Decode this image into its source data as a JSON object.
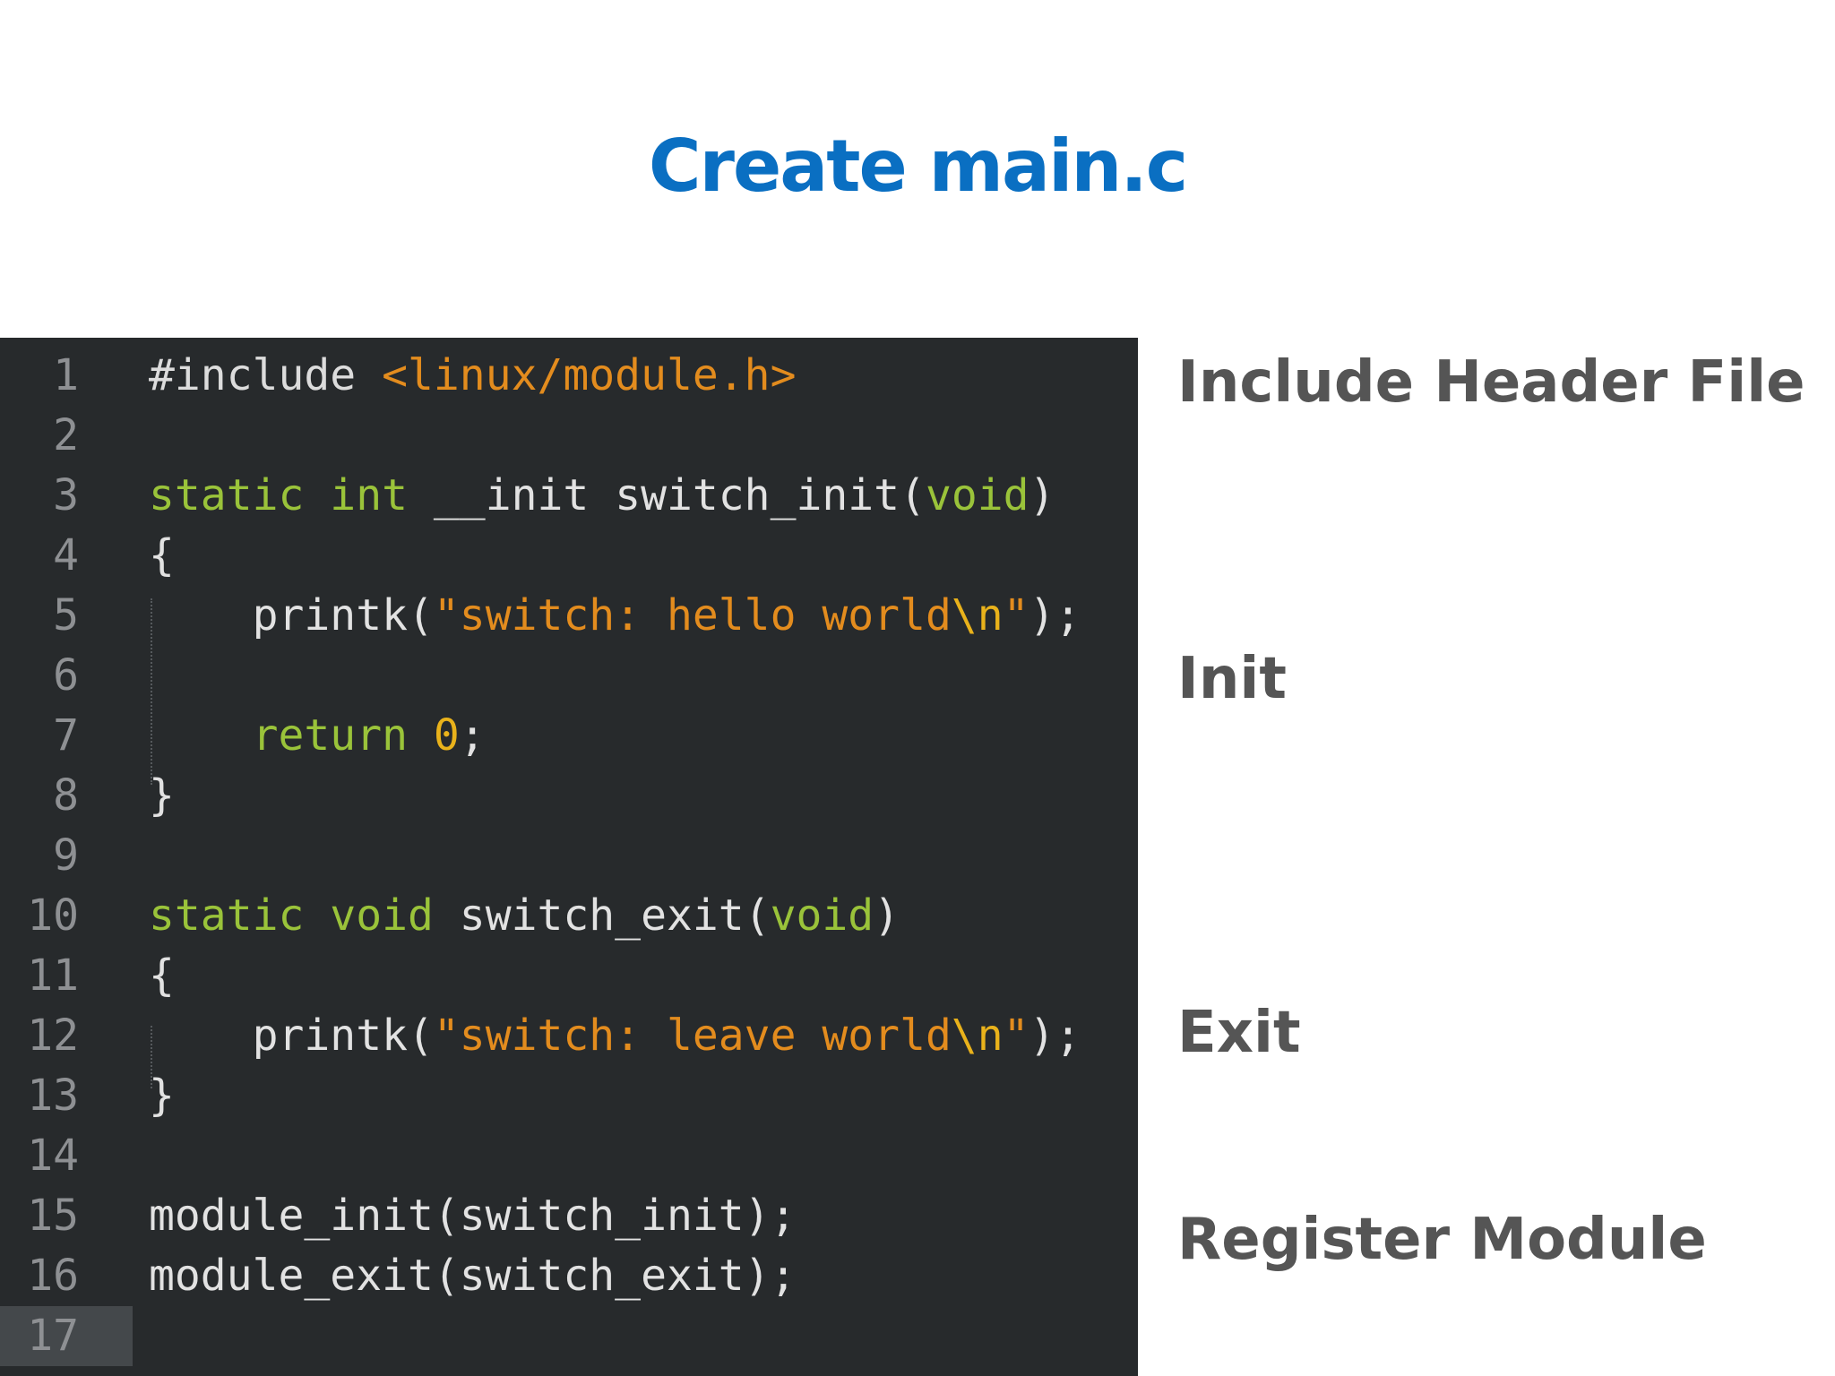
{
  "slide": {
    "title": "Create main.c"
  },
  "editor": {
    "current_line": 17,
    "lines": [
      {
        "number": "1",
        "tokens": [
          {
            "type": "pre",
            "text": "#include "
          },
          {
            "type": "inc",
            "text": "<linux/module.h>"
          }
        ]
      },
      {
        "number": "2",
        "tokens": []
      },
      {
        "number": "3",
        "tokens": [
          {
            "type": "kw",
            "text": "static"
          },
          {
            "type": "id",
            "text": " "
          },
          {
            "type": "kw",
            "text": "int"
          },
          {
            "type": "id",
            "text": " __init switch_init("
          },
          {
            "type": "kw",
            "text": "void"
          },
          {
            "type": "id",
            "text": ")"
          }
        ]
      },
      {
        "number": "4",
        "tokens": [
          {
            "type": "punct",
            "text": "{"
          }
        ]
      },
      {
        "number": "5",
        "tokens": [
          {
            "type": "id",
            "text": "    printk("
          },
          {
            "type": "str",
            "text": "\"switch: hello world"
          },
          {
            "type": "esc",
            "text": "\\n"
          },
          {
            "type": "str",
            "text": "\""
          },
          {
            "type": "id",
            "text": ");"
          }
        ]
      },
      {
        "number": "6",
        "tokens": []
      },
      {
        "number": "7",
        "tokens": [
          {
            "type": "id",
            "text": "    "
          },
          {
            "type": "kw",
            "text": "return"
          },
          {
            "type": "id",
            "text": " "
          },
          {
            "type": "num",
            "text": "0"
          },
          {
            "type": "id",
            "text": ";"
          }
        ]
      },
      {
        "number": "8",
        "tokens": [
          {
            "type": "punct",
            "text": "}"
          }
        ]
      },
      {
        "number": "9",
        "tokens": []
      },
      {
        "number": "10",
        "tokens": [
          {
            "type": "kw",
            "text": "static"
          },
          {
            "type": "id",
            "text": " "
          },
          {
            "type": "kw",
            "text": "void"
          },
          {
            "type": "id",
            "text": " switch_exit("
          },
          {
            "type": "kw",
            "text": "void"
          },
          {
            "type": "id",
            "text": ")"
          }
        ]
      },
      {
        "number": "11",
        "tokens": [
          {
            "type": "punct",
            "text": "{"
          }
        ]
      },
      {
        "number": "12",
        "tokens": [
          {
            "type": "id",
            "text": "    printk("
          },
          {
            "type": "str",
            "text": "\"switch: leave world"
          },
          {
            "type": "esc",
            "text": "\\n"
          },
          {
            "type": "str",
            "text": "\""
          },
          {
            "type": "id",
            "text": ");"
          }
        ]
      },
      {
        "number": "13",
        "tokens": [
          {
            "type": "punct",
            "text": "}"
          }
        ]
      },
      {
        "number": "14",
        "tokens": []
      },
      {
        "number": "15",
        "tokens": [
          {
            "type": "id",
            "text": "module_init(switch_init);"
          }
        ]
      },
      {
        "number": "16",
        "tokens": [
          {
            "type": "id",
            "text": "module_exit(switch_exit);"
          }
        ]
      },
      {
        "number": "17",
        "tokens": []
      }
    ]
  },
  "annotations": {
    "include": "Include Header File",
    "init": "Init",
    "exit": "Exit",
    "register": "Register Module"
  },
  "colors": {
    "title": "#0a6fc2",
    "editor_background": "#272a2c",
    "keyword": "#9ac33a",
    "string": "#e38c1e",
    "number": "#e9b21b",
    "annotation": "#555555"
  }
}
